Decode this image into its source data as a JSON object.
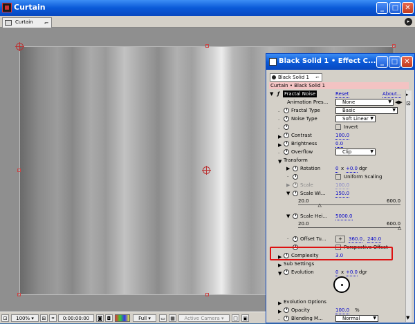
{
  "window": {
    "title": "Curtain",
    "tab": "Curtain",
    "tab_close": "⌐"
  },
  "statusbar": {
    "zoom": "100%",
    "timecode": "0:00:00:00",
    "resolution": "Full",
    "camera": "Active Camera"
  },
  "panel": {
    "title": "Black Solid 1 • Effect C...",
    "tab": "Black Solid 1",
    "tab_close": "⌐",
    "breadcrumb": "Curtain • Black Solid 1",
    "effect": {
      "name": "Fractal Noise",
      "reset": "Reset",
      "about": "About..."
    },
    "animation_presets": {
      "label": "Animation Pres...",
      "value": "None"
    },
    "fractal_type": {
      "label": "Fractal Type",
      "value": "Basic"
    },
    "noise_type": {
      "label": "Noise Type",
      "value": "Soft Linear"
    },
    "invert": {
      "label": "Invert"
    },
    "contrast": {
      "label": "Contrast",
      "value": "100.0"
    },
    "brightness": {
      "label": "Brightness",
      "value": "0.0"
    },
    "overflow": {
      "label": "Overflow",
      "value": "Clip"
    },
    "transform": {
      "label": "Transform"
    },
    "rotation": {
      "label": "Rotation",
      "turns": "0",
      "sep": "x",
      "value": "+0.0",
      "unit": "dgr"
    },
    "uniform_scaling": {
      "label": "Uniform Scaling"
    },
    "scale": {
      "label": "Scale",
      "value": "100.0"
    },
    "scale_width": {
      "label": "Scale Wi...",
      "value": "150.0",
      "min": "20.0",
      "max": "600.0",
      "level": 0.22
    },
    "scale_height": {
      "label": "Scale Hei...",
      "value": "5000.0",
      "min": "20.0",
      "max": "600.0",
      "level": 1.0
    },
    "offset_turbulence": {
      "label": "Offset Tu...",
      "x": "360.0",
      "sep": ",",
      "y": "240.0"
    },
    "perspective_offset": {
      "label": "Perspective Offset"
    },
    "complexity": {
      "label": "Complexity",
      "value": "3.0"
    },
    "sub_settings": {
      "label": "Sub Settings"
    },
    "evolution": {
      "label": "Evolution",
      "turns": "0",
      "sep": "x",
      "value": "+0.0",
      "unit": "dgr"
    },
    "evolution_options": {
      "label": "Evolution Options"
    },
    "opacity": {
      "label": "Opacity",
      "value": "100.0",
      "unit": "%"
    },
    "blending_mode": {
      "label": "Blending M...",
      "value": "Normal"
    }
  }
}
